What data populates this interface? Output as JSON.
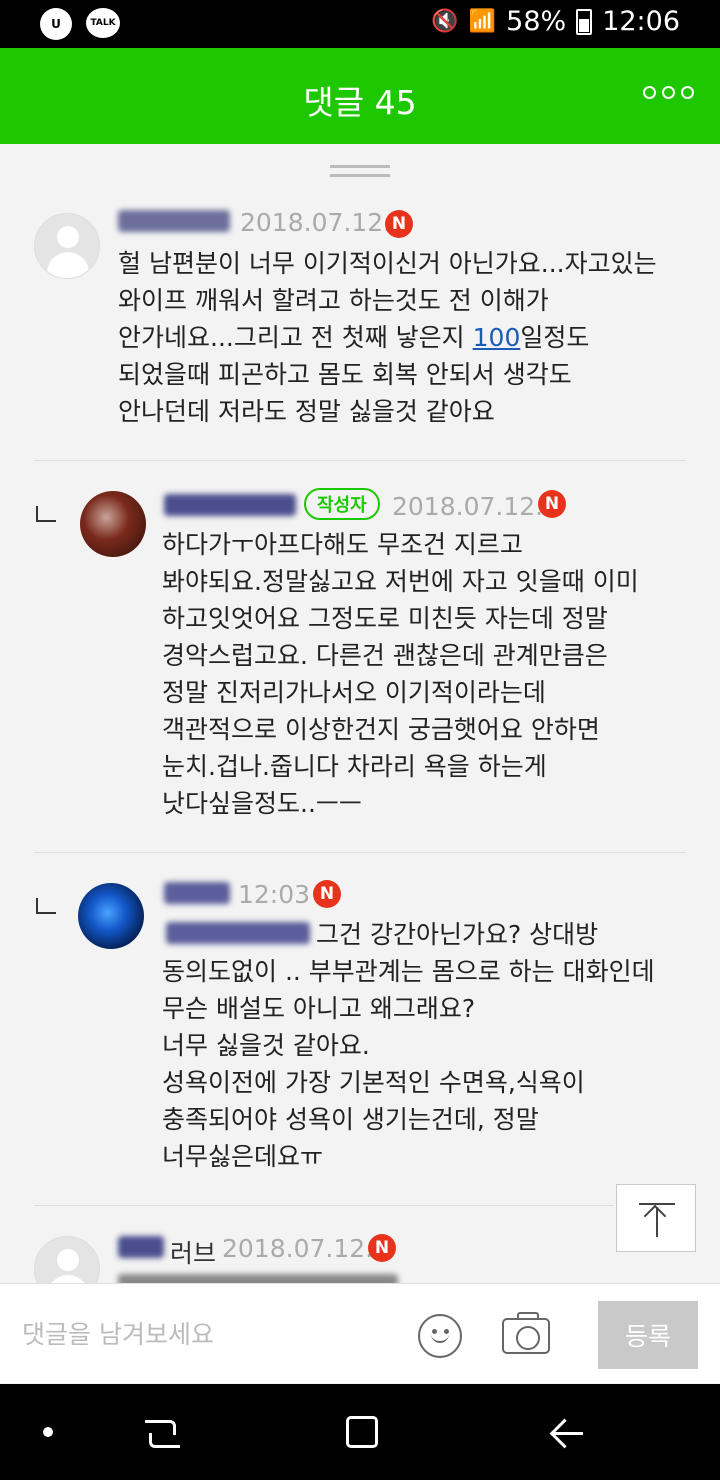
{
  "status_bar": {
    "app_icon_label": "U",
    "talk_icon_label": "TALK",
    "battery": "58%",
    "time": "12:06",
    "icons": [
      "mute-icon",
      "wifi-icon",
      "signal-icon",
      "battery-icon"
    ]
  },
  "header": {
    "title": "댓글 45",
    "more_icon": "more-dots-icon"
  },
  "comments": [
    {
      "date": "2018.07.12.",
      "badge": "N",
      "text": "헐 남편분이 너무 이기적이신거 아닌가요...자고있는\n와이프 깨워서 할려고 하는것도 전 이해가\n안가네요...그리고 전 첫째 낳은지 ",
      "link_text": "100",
      "text_after": "일정도\n되었을때 피곤하고 몸도 회복 안되서 생각도\n안나던데 저라도 정말 싫을것 같아요"
    },
    {
      "author_badge": "작성자",
      "date": "2018.07.12.",
      "badge": "N",
      "text": "하다가ㅜ아프다해도 무조건 지르고\n봐야되요.정말싫고요 저번에 자고 잇을때 이미\n하고잇엇어요 그정도로 미친듯 자는데 정말\n경악스럽고요. 다른건 괜찮은데 관계만큼은\n정말 진저리가나서오 이기적이라는데\n객관적으로 이상한건지 궁금햇어요 안하면\n눈치.겁나.줍니다 차라리 욕을 하는게\n낫다싶을정도..ㅡㅡ"
    },
    {
      "date": "12:03",
      "badge": "N",
      "text": "그건 강간아닌가요? 상대방\n동의도없이 .. 부부관계는 몸으로 하는 대화인데\n무슨 배설도 아니고 왜그래요?\n너무 싫을것 같아요.\n성욕이전에 가장 기본적인 수면욕,식욕이\n충족되어야 성욕이 생기는건데, 정말\n너무싫은데요ㅠ"
    },
    {
      "name_suffix": "러브",
      "date": "2018.07.12.",
      "badge": "N"
    }
  ],
  "input": {
    "placeholder": "댓글을 남겨보세요",
    "submit_label": "등록"
  },
  "colors": {
    "brand_green": "#1ec800",
    "badge_red": "#e8331c",
    "link_blue": "#1a5bb8"
  },
  "nav_bar": {
    "icons": [
      "nav-dot-icon",
      "recent-apps-icon",
      "home-icon",
      "back-icon"
    ]
  }
}
